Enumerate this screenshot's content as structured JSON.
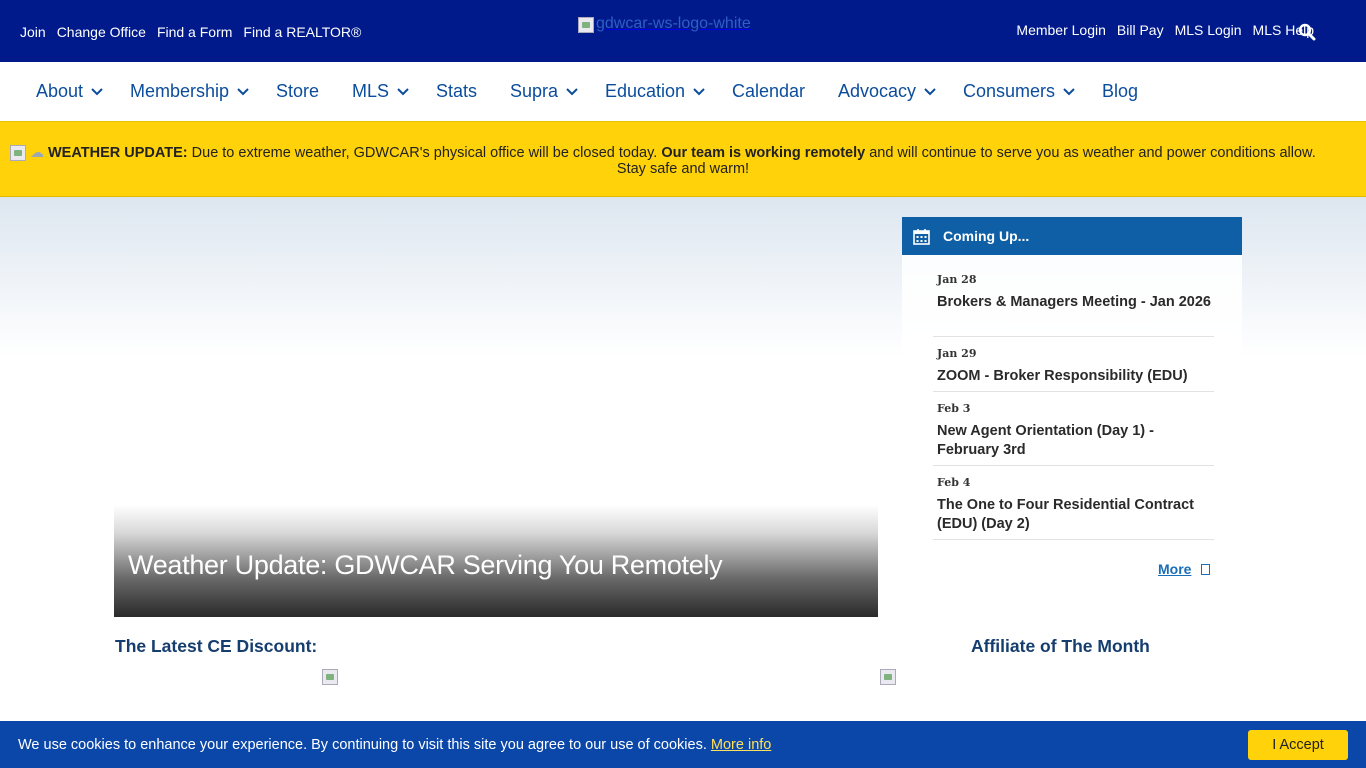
{
  "topbar": {
    "left_links": [
      "Join",
      "Change Office",
      "Find a Form",
      "Find a REALTOR®"
    ],
    "logo_alt": "gdwcar-ws-logo-white",
    "right_links": [
      "Member Login",
      "Bill Pay",
      "MLS Login",
      "MLS Help"
    ],
    "search_icon": "search-icon"
  },
  "nav": {
    "items": [
      {
        "label": "About",
        "dropdown": true
      },
      {
        "label": "Membership",
        "dropdown": true
      },
      {
        "label": "Store",
        "dropdown": false
      },
      {
        "label": "MLS",
        "dropdown": true
      },
      {
        "label": "Stats",
        "dropdown": false
      },
      {
        "label": "Supra",
        "dropdown": true
      },
      {
        "label": "Education",
        "dropdown": true
      },
      {
        "label": "Calendar",
        "dropdown": false
      },
      {
        "label": "Advocacy",
        "dropdown": true
      },
      {
        "label": "Consumers",
        "dropdown": true
      },
      {
        "label": "Blog",
        "dropdown": false
      }
    ]
  },
  "alert": {
    "label": "WEATHER UPDATE:",
    "text1": " Due to extreme weather, GDWCAR's physical office will be closed today. ",
    "bold2": "Our team is working remotely",
    "text3": " and will continue to serve you as weather and power conditions allow.",
    "line2": "Stay safe and warm!"
  },
  "slider": {
    "title": "Weather Update: GDWCAR Serving You Remotely"
  },
  "events": {
    "title": "Coming Up...",
    "items": [
      {
        "date": "Jan 28",
        "title": "Brokers & Managers Meeting - Jan 2026"
      },
      {
        "date": "Jan 29",
        "title": "ZOOM - Broker Responsibility (EDU)"
      },
      {
        "date": "Feb 3",
        "title": "New Agent Orientation (Day 1) - February 3rd"
      },
      {
        "date": "Feb 4",
        "title": "The One to Four Residential Contract (EDU) (Day 2)"
      }
    ],
    "more": "More"
  },
  "sections": {
    "ce_heading": "The Latest CE Discount:",
    "affiliate_heading": "Affiliate of The Month"
  },
  "cookie": {
    "text": "We use cookies to enhance your experience. By continuing to visit this site you agree to our use of cookies. ",
    "more_info": "More info",
    "accept": "I Accept"
  },
  "colors": {
    "topbar": "#001a8c",
    "nav_text": "#0b4d9c",
    "alert_bg": "#ffd20a",
    "events_header": "#0f5fa6",
    "cookie_bg": "#0a47a8"
  }
}
